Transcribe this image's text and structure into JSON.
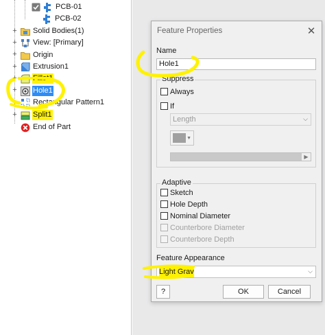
{
  "browser": {
    "items": [
      {
        "label": "PCB-01",
        "icon": "part-icon"
      },
      {
        "label": "PCB-02",
        "icon": "part-icon"
      },
      {
        "label": "Solid Bodies(1)",
        "icon": "folder-icon"
      },
      {
        "label": "View: [Primary]",
        "icon": "view-icon"
      },
      {
        "label": "Origin",
        "icon": "folder-icon"
      },
      {
        "label": "Extrusion1",
        "icon": "extrusion-icon"
      },
      {
        "label": "Fillet1",
        "icon": "fillet-icon"
      },
      {
        "label": "Hole1",
        "icon": "hole-icon"
      },
      {
        "label": "Rectangular Pattern1",
        "icon": "pattern-icon"
      },
      {
        "label": "Split1",
        "icon": "split-icon"
      },
      {
        "label": "End of Part",
        "icon": "end-of-part-icon"
      }
    ],
    "expanders": [
      "+",
      "+",
      "+",
      "+",
      "+",
      "+",
      "+",
      "+"
    ],
    "highlight_color": "#fff200",
    "selection_color": "#2f8cf5"
  },
  "dialog": {
    "title": "Feature Properties",
    "close_glyph": "✕",
    "name_label": "Name",
    "name_value": "Hole1",
    "suppress": {
      "title": "Suppress",
      "always_label": "Always",
      "always_checked": false,
      "if_label": "If",
      "if_checked": false,
      "parameter_value": "Length",
      "color_swatch": "#a0a0a0"
    },
    "adaptive": {
      "title": "Adaptive",
      "options": [
        {
          "label": "Sketch",
          "checked": false,
          "enabled": true
        },
        {
          "label": "Hole Depth",
          "checked": false,
          "enabled": true
        },
        {
          "label": "Nominal Diameter",
          "checked": false,
          "enabled": true
        },
        {
          "label": "Counterbore Diameter",
          "checked": false,
          "enabled": false
        },
        {
          "label": "Counterbore Depth",
          "checked": false,
          "enabled": false
        }
      ]
    },
    "appearance_label": "Feature Appearance",
    "appearance_value": "Light Gray",
    "help_glyph": "?",
    "ok_label": "OK",
    "cancel_label": "Cancel"
  },
  "colors": {
    "dialog_bg": "#f0f0f0",
    "graphics_bg": "#e9e9ea",
    "annotation_yellow": "#fff200"
  }
}
